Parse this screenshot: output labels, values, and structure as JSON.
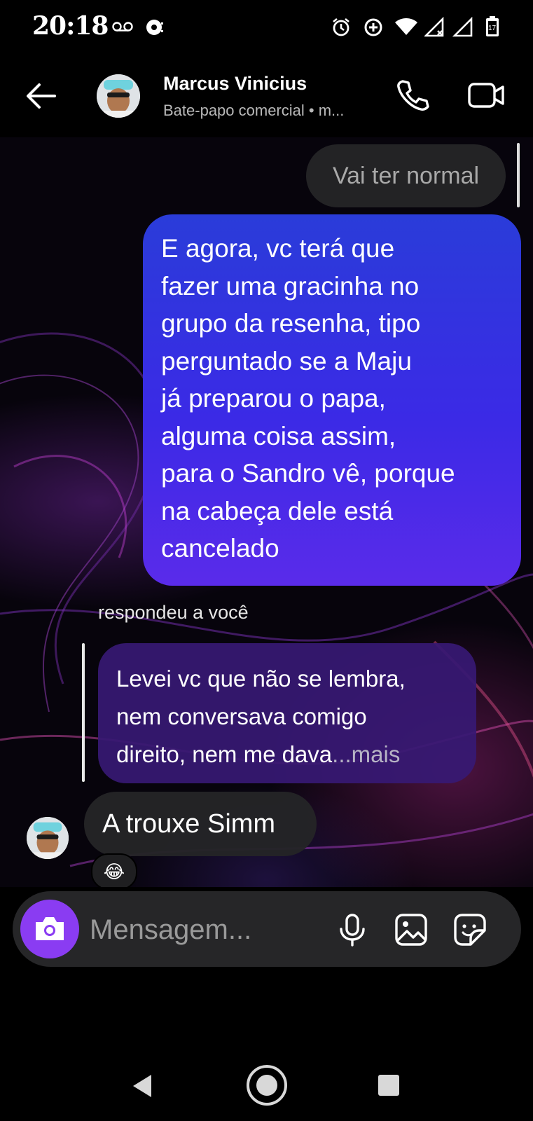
{
  "status_bar": {
    "time": "20:18",
    "icons": [
      "voicemail-icon",
      "stopwatch-icon",
      "alarm-icon",
      "data-saver-icon",
      "wifi-icon",
      "signal-no-data-icon",
      "signal-icon",
      "battery-icon"
    ],
    "battery_level": "17"
  },
  "header": {
    "contact_name": "Marcus Vinicius",
    "subtitle": "Bate-papo comercial • m...",
    "icons": [
      "back-arrow-icon",
      "phone-icon",
      "video-camera-icon"
    ]
  },
  "messages": [
    {
      "type": "outgoing-grey",
      "text": "Vai ter normal"
    },
    {
      "type": "outgoing",
      "lines": [
        "E agora, vc terá que",
        "fazer uma gracinha no",
        "grupo da resenha, tipo",
        "perguntado se a Maju",
        "já preparou o papa,",
        "alguma coisa assim,",
        "para o Sandro vê, porque",
        "na cabeça dele está",
        "cancelado"
      ]
    },
    {
      "type": "reply-quote",
      "label": "respondeu a você",
      "lines": [
        "Levei vc que não se lembra,",
        "nem conversava comigo",
        "direito, nem me dava"
      ],
      "more": "...mais"
    },
    {
      "type": "incoming",
      "text": "A trouxe Simm",
      "reaction": "😂"
    }
  ],
  "composer": {
    "placeholder": "Mensagem...",
    "icons": [
      "camera-icon",
      "microphone-icon",
      "image-icon",
      "sticker-icon"
    ],
    "accent_color": "#8a3cf2"
  },
  "nav_bar": {
    "icons": [
      "back-triangle-icon",
      "home-circle-icon",
      "recents-square-icon"
    ]
  },
  "colors": {
    "outgoing_bubble": "#3b2ae6",
    "quote_bubble": "#37197a",
    "incoming_bubble": "#242426"
  }
}
